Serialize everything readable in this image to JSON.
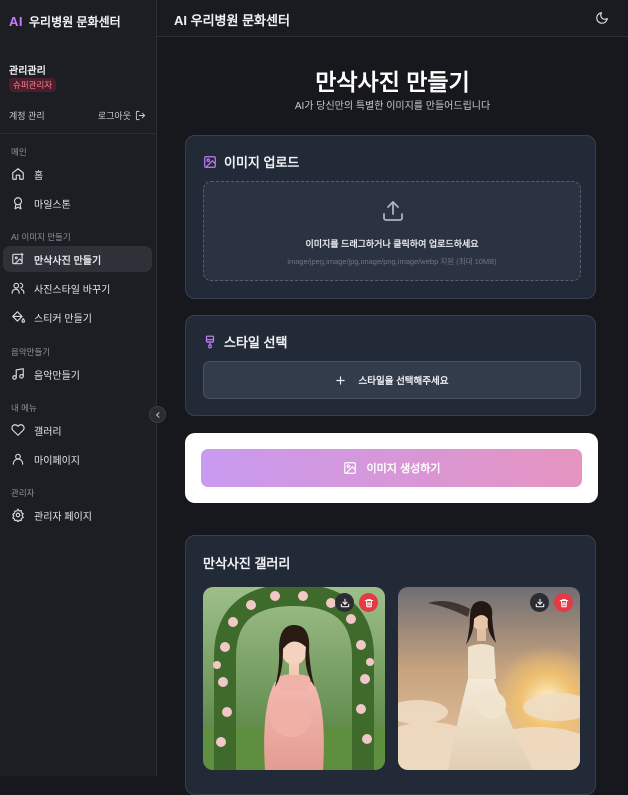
{
  "brand": {
    "logo": "AI",
    "name": "우리병원 문화센터"
  },
  "user": {
    "name": "관리관리",
    "role": "슈퍼관리자"
  },
  "account": {
    "label": "계정 관리",
    "logout": "로그아웃"
  },
  "sidebar": {
    "sections": [
      "메인",
      "AI 이미지 만들기",
      "음악만들기",
      "내 메뉴",
      "관리자"
    ],
    "items": [
      {
        "label": "홈",
        "icon": "home-icon"
      },
      {
        "label": "마일스톤",
        "icon": "award-icon"
      },
      {
        "label": "만삭사진 만들기",
        "icon": "image-edit-icon",
        "active": true
      },
      {
        "label": "사진스타일 바꾸기",
        "icon": "users-icon"
      },
      {
        "label": "스티커 만들기",
        "icon": "paint-bucket-icon"
      },
      {
        "label": "음악만들기",
        "icon": "music-icon"
      },
      {
        "label": "갤러리",
        "icon": "heart-icon"
      },
      {
        "label": "마이페이지",
        "icon": "user-icon"
      },
      {
        "label": "관리자 페이지",
        "icon": "gear-icon"
      }
    ]
  },
  "header": {
    "title": "AI 우리병원 문화센터",
    "theme_icon": "moon-icon"
  },
  "main": {
    "title": "만삭사진 만들기",
    "subtitle": "AI가 당신만의 특별한 이미지를 만들어드립니다",
    "upload": {
      "heading": "이미지 업로드",
      "text": "이미지를 드래그하거나 클릭하여 업로드하세요",
      "hint": "image/jpeg,image/jpg,image/png,image/webp 지원 (최대 10MB)"
    },
    "style": {
      "heading": "스타일 선택",
      "button": "스타일을 선택해주세요"
    },
    "generate": {
      "button": "이미지 생성하기"
    },
    "gallery": {
      "heading": "만삭사진 갤러리"
    }
  },
  "colors": {
    "accent": "#c77dff",
    "generate_start": "#c89af0",
    "generate_end": "#e694c0",
    "delete": "#e23b45"
  }
}
